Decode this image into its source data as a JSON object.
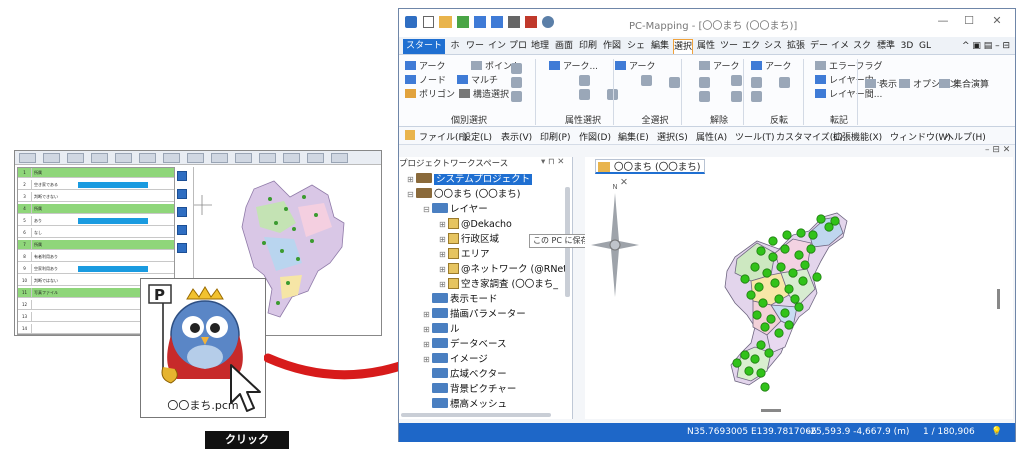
{
  "thumbnail": {
    "grid_rows": [
      {
        "num": "1",
        "text": "所属",
        "style": "green"
      },
      {
        "num": "2",
        "text": "空き家である",
        "style": "blue"
      },
      {
        "num": "3",
        "text": "判断できない",
        "style": "plain"
      },
      {
        "num": "4",
        "text": "所属",
        "style": "green"
      },
      {
        "num": "5",
        "text": "あり",
        "style": "blue"
      },
      {
        "num": "6",
        "text": "なし",
        "style": "plain"
      },
      {
        "num": "7",
        "text": "所属",
        "style": "green"
      },
      {
        "num": "8",
        "text": "有者利用あり",
        "style": "plain"
      },
      {
        "num": "9",
        "text": "空家利用あり",
        "style": "blue"
      },
      {
        "num": "10",
        "text": "判断ではない",
        "style": "plain"
      },
      {
        "num": "11",
        "text": "写真ファイル",
        "style": "green"
      },
      {
        "num": "12",
        "text": "",
        "style": "plain"
      },
      {
        "num": "13",
        "text": "",
        "style": "plain"
      },
      {
        "num": "14",
        "text": "",
        "style": "plain"
      }
    ]
  },
  "card": {
    "file_label": "〇〇まち.pcm"
  },
  "click_label": "クリック",
  "app": {
    "title": "PC-Mapping - [〇〇まち (〇〇まち)]",
    "ribbon_tabs": [
      "スタート",
      "ホーム",
      "ワーク",
      "インボ",
      "プロ",
      "地理",
      "画面",
      "印刷",
      "作図",
      "シェイ",
      "編集",
      "選択",
      "属性",
      "ツール",
      "エクス",
      "シス",
      "拡張",
      "データ",
      "イメ",
      "スクリ",
      "標準",
      "3D",
      "GL"
    ],
    "selected_tab": "選択",
    "ribbon_items": [
      {
        "label": "アーク",
        "color": "#3f7bd6"
      },
      {
        "label": "ポイント",
        "color": "#9aa7b8"
      },
      {
        "label": "ノード",
        "color": "#3f7bd6"
      },
      {
        "label": "マルチ",
        "color": "#3f7bd6"
      },
      {
        "label": "ポリゴン",
        "color": "#e2a33d"
      },
      {
        "label": "構造選択",
        "color": "#777777"
      },
      {
        "label": "アーク...",
        "color": "#3f7bd6"
      },
      {
        "label": "アーク",
        "color": "#3f7bd6"
      },
      {
        "label": "アーク",
        "color": "#9aa7b8"
      },
      {
        "label": "アーク",
        "color": "#3f7bd6"
      },
      {
        "label": "エラーフラグ",
        "color": "#9aa7b8"
      },
      {
        "label": "レイヤー内...",
        "color": "#3f7bd6"
      },
      {
        "label": "レイヤー間...",
        "color": "#3f7bd6"
      },
      {
        "label": "表示",
        "color": "#9aa7b8"
      },
      {
        "label": "オプション",
        "color": "#9aa7b8"
      },
      {
        "label": "集合演算",
        "color": "#9aa7b8"
      }
    ],
    "ribbon_groups": [
      "個別選択",
      "属性選択",
      "全選択",
      "解除",
      "反転",
      "転記"
    ],
    "menus": [
      "ファイル(F)",
      "設定(L)",
      "表示(V)",
      "印刷(P)",
      "作図(D)",
      "編集(E)",
      "選択(S)",
      "属性(A)",
      "ツール(T)",
      "カスタマイズ(C)",
      "拡張機能(X)",
      "ウィンドウ(W)",
      "ヘルプ(H)"
    ],
    "project_pane_title": "プロジェクトワークスペース",
    "tree": [
      {
        "label": "システムプロジェクト",
        "indent": 0,
        "icon": "project",
        "exp": "⊞",
        "highlight": true
      },
      {
        "label": "〇〇まち (〇〇まち)",
        "indent": 0,
        "icon": "project",
        "exp": "⊟",
        "highlight": false
      },
      {
        "label": "レイヤー",
        "indent": 1,
        "icon": "folder",
        "exp": "⊟",
        "highlight": false
      },
      {
        "label": "@Dekacho",
        "indent": 2,
        "icon": "layer",
        "exp": "⊞",
        "highlight": false
      },
      {
        "label": "行政区域",
        "indent": 2,
        "icon": "layer",
        "exp": "⊞",
        "highlight": false
      },
      {
        "label": "エリア",
        "indent": 2,
        "icon": "layer",
        "exp": "⊞",
        "highlight": false
      },
      {
        "label": "@ネットワーク (@RNet)",
        "indent": 2,
        "icon": "layer",
        "exp": "⊞",
        "highlight": false
      },
      {
        "label": "空き家調査 (〇〇まち_",
        "indent": 2,
        "icon": "layer",
        "exp": "⊞",
        "highlight": false
      },
      {
        "label": "表示モード",
        "indent": 1,
        "icon": "folder",
        "exp": "",
        "highlight": false
      },
      {
        "label": "描画パラメーター",
        "indent": 1,
        "icon": "folder",
        "exp": "⊞",
        "highlight": false
      },
      {
        "label": "ル",
        "indent": 1,
        "icon": "folder",
        "exp": "⊞",
        "highlight": false
      },
      {
        "label": "データベース",
        "indent": 1,
        "icon": "folder",
        "exp": "⊞",
        "highlight": false
      },
      {
        "label": "イメージ",
        "indent": 1,
        "icon": "folder",
        "exp": "⊞",
        "highlight": false
      },
      {
        "label": "広域ベクター",
        "indent": 1,
        "icon": "folder",
        "exp": "",
        "highlight": false
      },
      {
        "label": "背景ピクチャー",
        "indent": 1,
        "icon": "folder",
        "exp": "",
        "highlight": false
      },
      {
        "label": "標高メッシュ",
        "indent": 1,
        "icon": "folder",
        "exp": "",
        "highlight": false
      }
    ],
    "tooltip": "この PC に保存済み",
    "map_tab": "〇〇まち (〇〇まち)",
    "compass_letter": "N",
    "status": {
      "latlon": "N35.7693005 E139.7817066",
      "xy": "-25,593.9 -4,667.9 (m)",
      "scale": "1 / 180,906"
    },
    "colors": {
      "accent": "#1f6fd1",
      "status_bar": "#1e67c8",
      "selected_tab_border": "#f0a23c"
    }
  }
}
